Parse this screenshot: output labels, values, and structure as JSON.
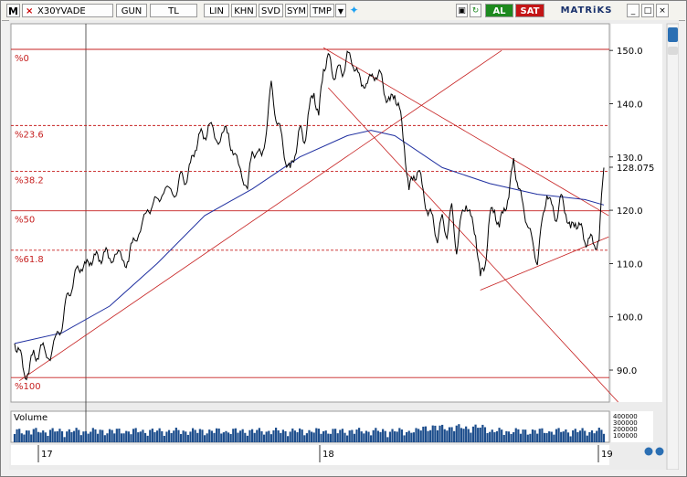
{
  "toolbar": {
    "symbol_box": "M",
    "symbol": "X30YVADE",
    "period": "GUN",
    "currency": "TL",
    "scale_buttons": [
      "LIN",
      "KHN",
      "SVD",
      "SYM",
      "TMP"
    ],
    "buy_label": "AL",
    "sell_label": "SAT",
    "brand": "MATRiKS",
    "window_buttons": [
      "_",
      "□",
      "×"
    ]
  },
  "chart_data": {
    "type": "line",
    "title": "",
    "y_ticks": [
      150,
      140,
      130,
      120,
      110,
      100,
      90
    ],
    "ylim": [
      84,
      155
    ],
    "current_value": "128.075",
    "x_ticks": [
      "17",
      "18",
      "19"
    ],
    "fibonacci_levels": [
      {
        "label": "%0",
        "value": 150.2
      },
      {
        "label": "%23.6",
        "value": 135.9
      },
      {
        "label": "%38.2",
        "value": 127.3
      },
      {
        "label": "%50",
        "value": 119.9
      },
      {
        "label": "%61.8",
        "value": 112.5
      },
      {
        "label": "%100",
        "value": 88.6
      }
    ],
    "price_series": [
      [
        0,
        95
      ],
      [
        2,
        94
      ],
      [
        4,
        89
      ],
      [
        6,
        90
      ],
      [
        8,
        93
      ],
      [
        10,
        93
      ],
      [
        12,
        94
      ],
      [
        15,
        93
      ],
      [
        18,
        96
      ],
      [
        20,
        99
      ],
      [
        22,
        103
      ],
      [
        24,
        106
      ],
      [
        26,
        108
      ],
      [
        28,
        110
      ],
      [
        30,
        109
      ],
      [
        32,
        111
      ],
      [
        34,
        111
      ],
      [
        36,
        111
      ],
      [
        38,
        112
      ],
      [
        40,
        111
      ],
      [
        43,
        112
      ],
      [
        46,
        110
      ],
      [
        48,
        111
      ],
      [
        50,
        114
      ],
      [
        53,
        117
      ],
      [
        56,
        119
      ],
      [
        58,
        122
      ],
      [
        60,
        121
      ],
      [
        62,
        124
      ],
      [
        65,
        123
      ],
      [
        68,
        124
      ],
      [
        70,
        126
      ],
      [
        72,
        126
      ],
      [
        74,
        128
      ],
      [
        76,
        132
      ],
      [
        78,
        134
      ],
      [
        80,
        134
      ],
      [
        82,
        136
      ],
      [
        85,
        133
      ],
      [
        88,
        135
      ],
      [
        90,
        134
      ],
      [
        92,
        131
      ],
      [
        95,
        127
      ],
      [
        98,
        125
      ],
      [
        100,
        130
      ],
      [
        102,
        132
      ],
      [
        104,
        129
      ],
      [
        106,
        136
      ],
      [
        108,
        143
      ],
      [
        110,
        138
      ],
      [
        112,
        134
      ],
      [
        114,
        130
      ],
      [
        116,
        127
      ],
      [
        118,
        131
      ],
      [
        120,
        135
      ],
      [
        122,
        133
      ],
      [
        124,
        139
      ],
      [
        126,
        142
      ],
      [
        128,
        138
      ],
      [
        130,
        146
      ],
      [
        132,
        150
      ],
      [
        134,
        144
      ],
      [
        136,
        148
      ],
      [
        138,
        144
      ],
      [
        140,
        151
      ],
      [
        142,
        146
      ],
      [
        144,
        148
      ],
      [
        146,
        142
      ],
      [
        148,
        145
      ],
      [
        150,
        144
      ],
      [
        152,
        146
      ],
      [
        154,
        145
      ],
      [
        156,
        142
      ],
      [
        158,
        140
      ],
      [
        160,
        142
      ],
      [
        162,
        139
      ],
      [
        164,
        132
      ],
      [
        166,
        124
      ],
      [
        168,
        126
      ],
      [
        170,
        128
      ],
      [
        172,
        123
      ],
      [
        174,
        120
      ],
      [
        176,
        118
      ],
      [
        178,
        115
      ],
      [
        180,
        118
      ],
      [
        182,
        116
      ],
      [
        184,
        120
      ],
      [
        186,
        113
      ],
      [
        188,
        118
      ],
      [
        190,
        122
      ],
      [
        192,
        118
      ],
      [
        194,
        116
      ],
      [
        196,
        107
      ],
      [
        198,
        110
      ],
      [
        200,
        119
      ],
      [
        202,
        120
      ],
      [
        204,
        117
      ],
      [
        206,
        120
      ],
      [
        208,
        123
      ],
      [
        210,
        129
      ],
      [
        212,
        125
      ],
      [
        214,
        120
      ],
      [
        216,
        118
      ],
      [
        218,
        113
      ],
      [
        220,
        111
      ],
      [
        222,
        117
      ],
      [
        224,
        124
      ],
      [
        226,
        120
      ],
      [
        228,
        119
      ],
      [
        230,
        122
      ],
      [
        232,
        120
      ],
      [
        234,
        116
      ],
      [
        236,
        118
      ],
      [
        238,
        117
      ],
      [
        240,
        114
      ],
      [
        242,
        115
      ],
      [
        244,
        113
      ],
      [
        246,
        115
      ],
      [
        248,
        128
      ]
    ],
    "ma_series": [
      [
        0,
        95
      ],
      [
        20,
        97
      ],
      [
        40,
        102
      ],
      [
        60,
        110
      ],
      [
        80,
        119
      ],
      [
        100,
        124
      ],
      [
        120,
        130
      ],
      [
        140,
        134
      ],
      [
        150,
        135
      ],
      [
        160,
        134
      ],
      [
        180,
        128
      ],
      [
        200,
        125
      ],
      [
        220,
        123
      ],
      [
        240,
        122
      ],
      [
        248,
        121
      ]
    ],
    "volume_label": "Volume",
    "volume_ticks": [
      "400000",
      "300000",
      "200000",
      "100000"
    ]
  }
}
